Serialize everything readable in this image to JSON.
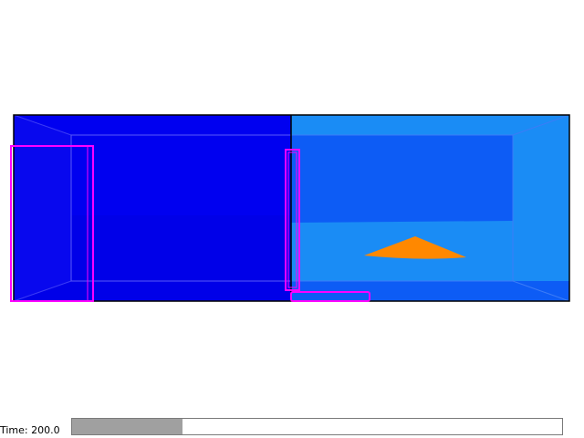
{
  "status": {
    "time_label": "Time: 200.0"
  },
  "progress": {
    "fraction": 0.225
  },
  "colors": {
    "tank_left": "#0000f0",
    "tank_left_back": "#0000e8",
    "tank_right": "#0d5cf5",
    "tank_right_light": "#1a8cf5",
    "object": "#ff8800",
    "highlight": "#ff00ff",
    "outline": "#000000"
  }
}
